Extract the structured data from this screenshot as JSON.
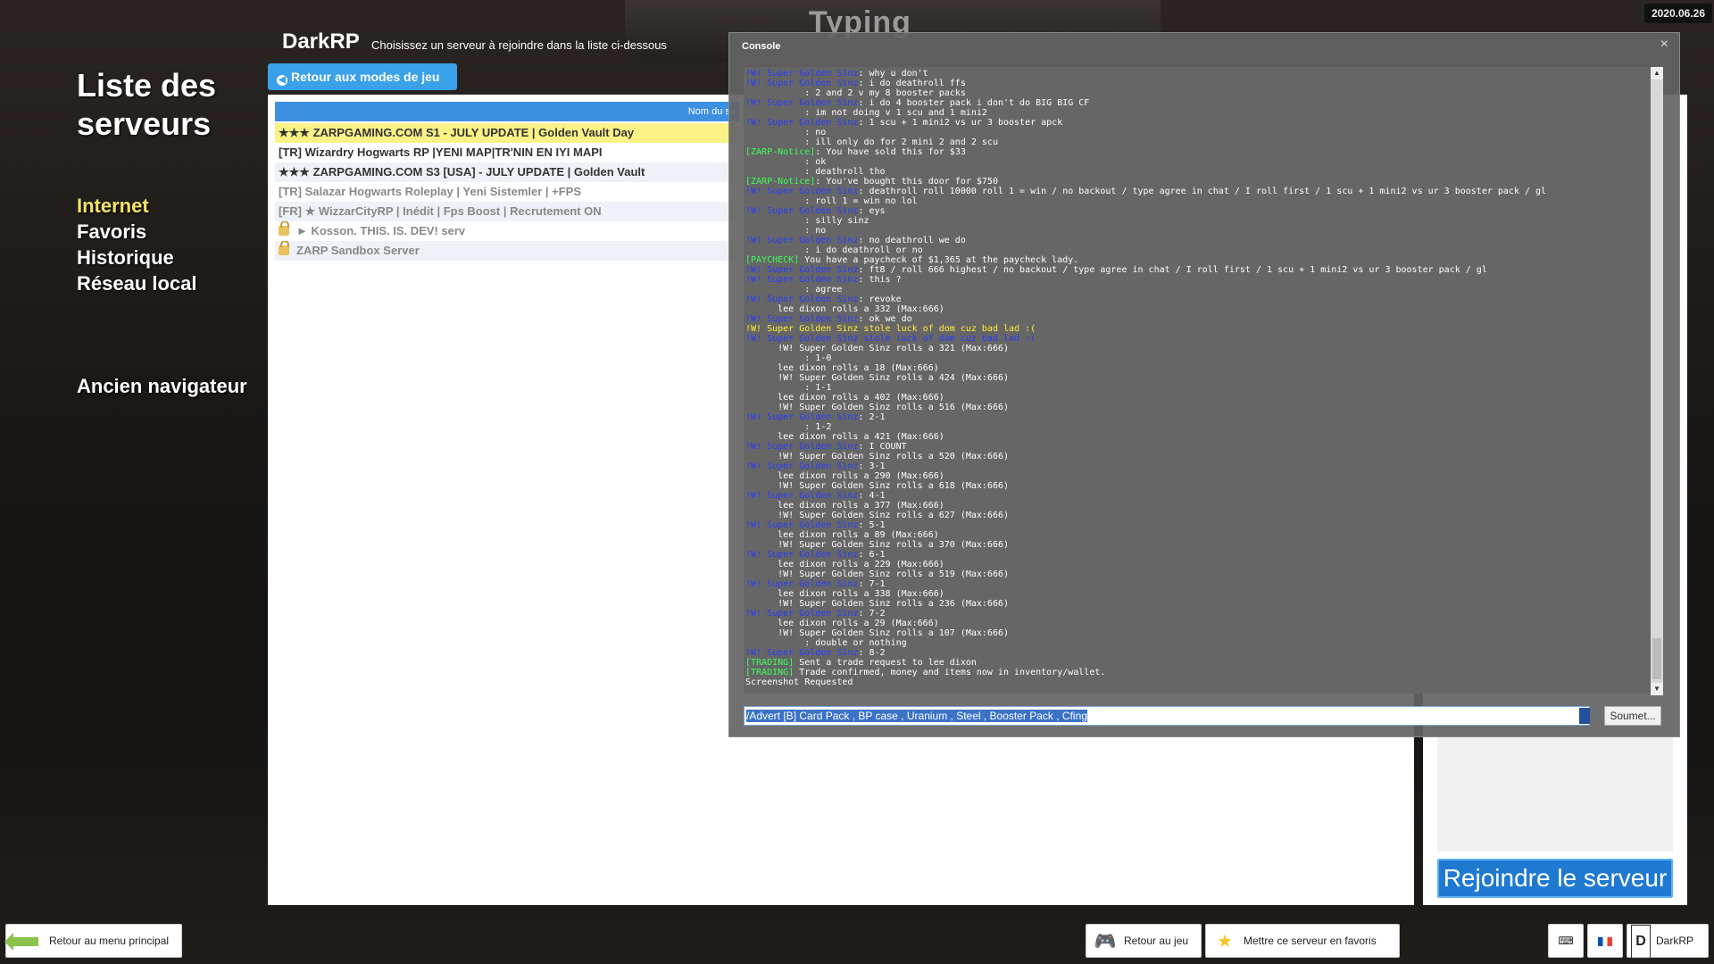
{
  "background": {
    "typing_text": "Typing",
    "date": "2020.06.26"
  },
  "left_menu": {
    "title_line1": "Liste des",
    "title_line2": "serveurs",
    "nav": [
      "Internet",
      "Favoris",
      "Historique",
      "Réseau local"
    ],
    "legacy_browser": "Ancien navigateur"
  },
  "header": {
    "gamemode": "DarkRP",
    "subtitle": "Choisissez un serveur à rejoindre dans la liste ci-dessous",
    "back_button": "Retour aux modes de jeu"
  },
  "server_list": {
    "column_header": "Nom du se",
    "rows": [
      "★★★ ZARPGAMING.COM S1 - JULY UPDATE | Golden Vault Day",
      "[TR] Wizardry Hogwarts RP |YENI MAP|TR'NIN EN IYI MAPI",
      "★★★ ZARPGAMING.COM S3 [USA] - JULY UPDATE | Golden Vault",
      "[TR] Salazar Hogwarts Roleplay | Yeni Sistemler | +FPS",
      "[FR] ★ WizzarCityRP | Inédit | Fps Boost | Recrutement ON",
      "► Kosson. THIS. IS. DEV! serv",
      "ZARP Sandbox Server"
    ]
  },
  "join_button": "Rejoindre le serveur",
  "console": {
    "title": "Console",
    "close": "×",
    "input_value": "/Advert [B] Card Pack , BP case , Uranium , Steel , Booster Pack , Cfing",
    "submit": "Soumet...",
    "lines": [
      {
        "p": "!W! Super Golden Sinz",
        "c": "s-blue",
        "t": ": why u don't"
      },
      {
        "p": "!W! Super Golden Sinz",
        "c": "s-blue",
        "t": ": i do deathroll ffs"
      },
      {
        "p": "           ",
        "c": "s-dim",
        "t": ": 2 and 2 v my 8 booster packs"
      },
      {
        "p": "!W! Super Golden Sinz",
        "c": "s-blue",
        "t": ": i do 4 booster pack i don't do BIG BIG CF"
      },
      {
        "p": "           ",
        "c": "s-dim",
        "t": ": im not doing v 1 scu and 1 mini2"
      },
      {
        "p": "!W! Super Golden Sinz",
        "c": "s-blue",
        "t": ": 1 scu + 1 mini2 vs ur 3 booster apck"
      },
      {
        "p": "           ",
        "c": "s-dim",
        "t": ": no"
      },
      {
        "p": "           ",
        "c": "s-dim",
        "t": ": ill only do for 2 mini 2 and 2 scu"
      },
      {
        "p": "[ZARP-Notice]",
        "c": "s-green",
        "t": ": You have sold this for $33"
      },
      {
        "p": "           ",
        "c": "s-dim",
        "t": ": ok"
      },
      {
        "p": "           ",
        "c": "s-dim",
        "t": ": deathroll tho"
      },
      {
        "p": "[ZARP-Notice]",
        "c": "s-green",
        "t": ": You've bought this door for $750"
      },
      {
        "p": "!W! Super Golden Sinz",
        "c": "s-blue",
        "t": ": deathroll roll 10000 roll 1 = win / no backout / type agree in chat / I roll first / 1 scu + 1 mini2 vs ur 3 booster pack / gl"
      },
      {
        "p": "           ",
        "c": "s-dim",
        "t": ": roll 1 = win no lol"
      },
      {
        "p": "!W! Super Golden Sinz",
        "c": "s-blue",
        "t": ": eys"
      },
      {
        "p": "           ",
        "c": "s-dim",
        "t": ": silly sinz"
      },
      {
        "p": "           ",
        "c": "s-dim",
        "t": ": no"
      },
      {
        "p": "!W! Super Golden Sinz",
        "c": "s-blue",
        "t": ": no deathroll we do"
      },
      {
        "p": "           ",
        "c": "s-dim",
        "t": ": i do deathroll or no"
      },
      {
        "p": "[PAYCHECK]",
        "c": "s-green",
        "t": " You have a paycheck of $1,365 at the paycheck lady."
      },
      {
        "p": "!W! Super Golden Sinz",
        "c": "s-blue",
        "t": ": ft8 / roll 666 highest / no backout / type agree in chat / I roll first / 1 scu + 1 mini2 vs ur 3 booster pack / gl"
      },
      {
        "p": "!W! Super Golden Sinz",
        "c": "s-blue",
        "t": ": this ?"
      },
      {
        "p": "           ",
        "c": "s-dim",
        "t": ": agree"
      },
      {
        "p": "!W! Super Golden Sinz",
        "c": "s-blue",
        "t": ": revoke"
      },
      {
        "p": "      ",
        "c": "s-red",
        "t": "lee dixon rolls a 332 (Max:666)"
      },
      {
        "p": "!W! Super Golden Sinz",
        "c": "s-blue",
        "t": ": ok we do"
      },
      {
        "p": "!W! Super Golden Sinz stole luck of dom cuz bad lad :(",
        "c": "s-yellow",
        "t": ""
      },
      {
        "p": "!W! Super Golden Sinz stole luck of dom cuz bad lad :(",
        "c": "s-blue",
        "t": ""
      },
      {
        "p": "      ",
        "c": "s-red",
        "t": "!W! Super Golden Sinz rolls a 321 (Max:666)"
      },
      {
        "p": "           ",
        "c": "s-dim",
        "t": ": 1-0"
      },
      {
        "p": "      ",
        "c": "s-red",
        "t": "lee dixon rolls a 18 (Max:666)"
      },
      {
        "p": "      ",
        "c": "s-red",
        "t": "!W! Super Golden Sinz rolls a 424 (Max:666)"
      },
      {
        "p": "           ",
        "c": "s-dim",
        "t": ": 1-1"
      },
      {
        "p": "      ",
        "c": "s-red",
        "t": "lee dixon rolls a 402 (Max:666)"
      },
      {
        "p": "      ",
        "c": "s-red",
        "t": "!W! Super Golden Sinz rolls a 516 (Max:666)"
      },
      {
        "p": "!W! Super Golden Sinz",
        "c": "s-blue",
        "t": ": 2-1"
      },
      {
        "p": "           ",
        "c": "s-dim",
        "t": ": 1-2"
      },
      {
        "p": "      ",
        "c": "s-red",
        "t": "lee dixon rolls a 421 (Max:666)"
      },
      {
        "p": "!W! Super Golden Sinz",
        "c": "s-blue",
        "t": ": I COUNT"
      },
      {
        "p": "      ",
        "c": "s-red",
        "t": "!W! Super Golden Sinz rolls a 520 (Max:666)"
      },
      {
        "p": "!W! Super Golden Sinz",
        "c": "s-blue",
        "t": ": 3-1"
      },
      {
        "p": "      ",
        "c": "s-red",
        "t": "lee dixon rolls a 290 (Max:666)"
      },
      {
        "p": "      ",
        "c": "s-red",
        "t": "!W! Super Golden Sinz rolls a 618 (Max:666)"
      },
      {
        "p": "!W! Super Golden Sinz",
        "c": "s-blue",
        "t": ": 4-1"
      },
      {
        "p": "      ",
        "c": "s-red",
        "t": "lee dixon rolls a 377 (Max:666)"
      },
      {
        "p": "      ",
        "c": "s-red",
        "t": "!W! Super Golden Sinz rolls a 627 (Max:666)"
      },
      {
        "p": "!W! Super Golden Sinz",
        "c": "s-blue",
        "t": ": 5-1"
      },
      {
        "p": "      ",
        "c": "s-red",
        "t": "lee dixon rolls a 89 (Max:666)"
      },
      {
        "p": "      ",
        "c": "s-red",
        "t": "!W! Super Golden Sinz rolls a 370 (Max:666)"
      },
      {
        "p": "!W! Super Golden Sinz",
        "c": "s-blue",
        "t": ": 6-1"
      },
      {
        "p": "      ",
        "c": "s-red",
        "t": "lee dixon rolls a 229 (Max:666)"
      },
      {
        "p": "      ",
        "c": "s-red",
        "t": "!W! Super Golden Sinz rolls a 519 (Max:666)"
      },
      {
        "p": "!W! Super Golden Sinz",
        "c": "s-blue",
        "t": ": 7-1"
      },
      {
        "p": "      ",
        "c": "s-red",
        "t": "lee dixon rolls a 338 (Max:666)"
      },
      {
        "p": "      ",
        "c": "s-red",
        "t": "!W! Super Golden Sinz rolls a 236 (Max:666)"
      },
      {
        "p": "!W! Super Golden Sinz",
        "c": "s-blue",
        "t": ": 7-2"
      },
      {
        "p": "      ",
        "c": "s-red",
        "t": "lee dixon rolls a 29 (Max:666)"
      },
      {
        "p": "      ",
        "c": "s-red",
        "t": "!W! Super Golden Sinz rolls a 107 (Max:666)"
      },
      {
        "p": "           ",
        "c": "s-dim",
        "t": ": double or nothing"
      },
      {
        "p": "!W! Super Golden Sinz",
        "c": "s-blue",
        "t": ": 8-2"
      },
      {
        "p": "[TRADING]",
        "c": "s-green",
        "t": " Sent a trade request to lee dixon"
      },
      {
        "p": "[TRADING]",
        "c": "s-green",
        "t": " Trade confirmed, money and items now in inventory/wallet."
      },
      {
        "p": "",
        "c": "s-dim",
        "t": "Screenshot Requested"
      }
    ]
  },
  "bottom_bar": {
    "back_main": "Retour au menu principal",
    "back_game": "Retour au jeu",
    "favorite": "Mettre ce serveur en favoris",
    "gamemode": "DarkRP"
  }
}
